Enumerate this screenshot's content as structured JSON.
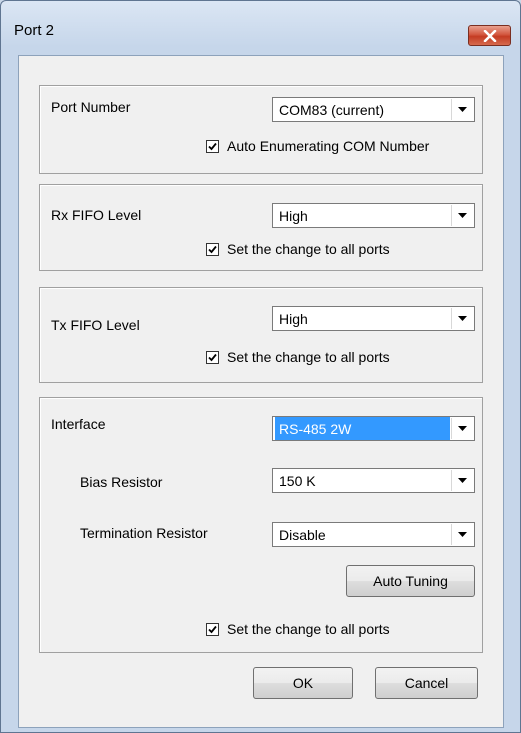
{
  "window": {
    "title": "Port 2"
  },
  "port_number": {
    "label": "Port Number",
    "selected": "COM83 (current)",
    "auto_enum_label": "Auto Enumerating COM Number",
    "auto_enum_checked": true
  },
  "rx_fifo": {
    "label": "Rx FIFO Level",
    "selected": "High",
    "apply_all_label": "Set the change to all ports",
    "apply_all_checked": true
  },
  "tx_fifo": {
    "label": "Tx FIFO Level",
    "selected": "High",
    "apply_all_label": "Set the change to all ports",
    "apply_all_checked": true
  },
  "interface": {
    "label": "Interface",
    "selected": "RS-485 2W",
    "bias_label": "Bias Resistor",
    "bias_selected": "150 K",
    "termination_label": "Termination Resistor",
    "termination_selected": "Disable",
    "auto_tuning_label": "Auto Tuning",
    "apply_all_label": "Set the change to all ports",
    "apply_all_checked": true
  },
  "buttons": {
    "ok_label": "OK",
    "cancel_label": "Cancel"
  },
  "colors": {
    "selection": "#3399ff",
    "close_button": "#c43b22"
  },
  "icons": {
    "close": "close-x-icon",
    "dropdown": "dropdown-arrow-icon",
    "checkmark": "checkmark-icon"
  }
}
